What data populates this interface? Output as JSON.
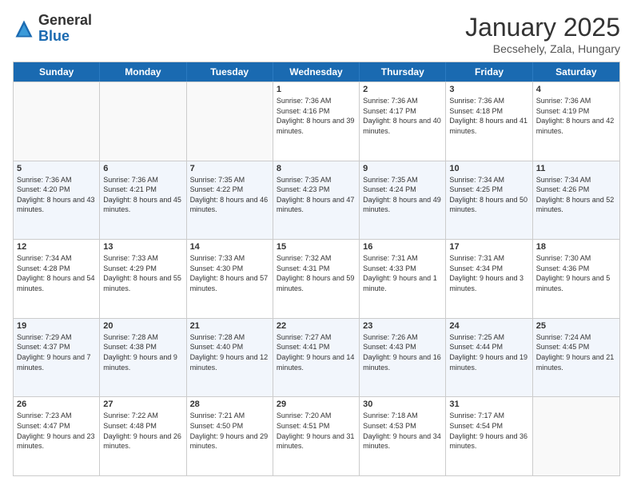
{
  "header": {
    "logo_general": "General",
    "logo_blue": "Blue",
    "month_title": "January 2025",
    "subtitle": "Becsehely, Zala, Hungary"
  },
  "days_of_week": [
    "Sunday",
    "Monday",
    "Tuesday",
    "Wednesday",
    "Thursday",
    "Friday",
    "Saturday"
  ],
  "rows": [
    [
      {
        "day": "",
        "text": ""
      },
      {
        "day": "",
        "text": ""
      },
      {
        "day": "",
        "text": ""
      },
      {
        "day": "1",
        "text": "Sunrise: 7:36 AM\nSunset: 4:16 PM\nDaylight: 8 hours\nand 39 minutes."
      },
      {
        "day": "2",
        "text": "Sunrise: 7:36 AM\nSunset: 4:17 PM\nDaylight: 8 hours\nand 40 minutes."
      },
      {
        "day": "3",
        "text": "Sunrise: 7:36 AM\nSunset: 4:18 PM\nDaylight: 8 hours\nand 41 minutes."
      },
      {
        "day": "4",
        "text": "Sunrise: 7:36 AM\nSunset: 4:19 PM\nDaylight: 8 hours\nand 42 minutes."
      }
    ],
    [
      {
        "day": "5",
        "text": "Sunrise: 7:36 AM\nSunset: 4:20 PM\nDaylight: 8 hours\nand 43 minutes."
      },
      {
        "day": "6",
        "text": "Sunrise: 7:36 AM\nSunset: 4:21 PM\nDaylight: 8 hours\nand 45 minutes."
      },
      {
        "day": "7",
        "text": "Sunrise: 7:35 AM\nSunset: 4:22 PM\nDaylight: 8 hours\nand 46 minutes."
      },
      {
        "day": "8",
        "text": "Sunrise: 7:35 AM\nSunset: 4:23 PM\nDaylight: 8 hours\nand 47 minutes."
      },
      {
        "day": "9",
        "text": "Sunrise: 7:35 AM\nSunset: 4:24 PM\nDaylight: 8 hours\nand 49 minutes."
      },
      {
        "day": "10",
        "text": "Sunrise: 7:34 AM\nSunset: 4:25 PM\nDaylight: 8 hours\nand 50 minutes."
      },
      {
        "day": "11",
        "text": "Sunrise: 7:34 AM\nSunset: 4:26 PM\nDaylight: 8 hours\nand 52 minutes."
      }
    ],
    [
      {
        "day": "12",
        "text": "Sunrise: 7:34 AM\nSunset: 4:28 PM\nDaylight: 8 hours\nand 54 minutes."
      },
      {
        "day": "13",
        "text": "Sunrise: 7:33 AM\nSunset: 4:29 PM\nDaylight: 8 hours\nand 55 minutes."
      },
      {
        "day": "14",
        "text": "Sunrise: 7:33 AM\nSunset: 4:30 PM\nDaylight: 8 hours\nand 57 minutes."
      },
      {
        "day": "15",
        "text": "Sunrise: 7:32 AM\nSunset: 4:31 PM\nDaylight: 8 hours\nand 59 minutes."
      },
      {
        "day": "16",
        "text": "Sunrise: 7:31 AM\nSunset: 4:33 PM\nDaylight: 9 hours\nand 1 minute."
      },
      {
        "day": "17",
        "text": "Sunrise: 7:31 AM\nSunset: 4:34 PM\nDaylight: 9 hours\nand 3 minutes."
      },
      {
        "day": "18",
        "text": "Sunrise: 7:30 AM\nSunset: 4:36 PM\nDaylight: 9 hours\nand 5 minutes."
      }
    ],
    [
      {
        "day": "19",
        "text": "Sunrise: 7:29 AM\nSunset: 4:37 PM\nDaylight: 9 hours\nand 7 minutes."
      },
      {
        "day": "20",
        "text": "Sunrise: 7:28 AM\nSunset: 4:38 PM\nDaylight: 9 hours\nand 9 minutes."
      },
      {
        "day": "21",
        "text": "Sunrise: 7:28 AM\nSunset: 4:40 PM\nDaylight: 9 hours\nand 12 minutes."
      },
      {
        "day": "22",
        "text": "Sunrise: 7:27 AM\nSunset: 4:41 PM\nDaylight: 9 hours\nand 14 minutes."
      },
      {
        "day": "23",
        "text": "Sunrise: 7:26 AM\nSunset: 4:43 PM\nDaylight: 9 hours\nand 16 minutes."
      },
      {
        "day": "24",
        "text": "Sunrise: 7:25 AM\nSunset: 4:44 PM\nDaylight: 9 hours\nand 19 minutes."
      },
      {
        "day": "25",
        "text": "Sunrise: 7:24 AM\nSunset: 4:45 PM\nDaylight: 9 hours\nand 21 minutes."
      }
    ],
    [
      {
        "day": "26",
        "text": "Sunrise: 7:23 AM\nSunset: 4:47 PM\nDaylight: 9 hours\nand 23 minutes."
      },
      {
        "day": "27",
        "text": "Sunrise: 7:22 AM\nSunset: 4:48 PM\nDaylight: 9 hours\nand 26 minutes."
      },
      {
        "day": "28",
        "text": "Sunrise: 7:21 AM\nSunset: 4:50 PM\nDaylight: 9 hours\nand 29 minutes."
      },
      {
        "day": "29",
        "text": "Sunrise: 7:20 AM\nSunset: 4:51 PM\nDaylight: 9 hours\nand 31 minutes."
      },
      {
        "day": "30",
        "text": "Sunrise: 7:18 AM\nSunset: 4:53 PM\nDaylight: 9 hours\nand 34 minutes."
      },
      {
        "day": "31",
        "text": "Sunrise: 7:17 AM\nSunset: 4:54 PM\nDaylight: 9 hours\nand 36 minutes."
      },
      {
        "day": "",
        "text": ""
      }
    ]
  ]
}
